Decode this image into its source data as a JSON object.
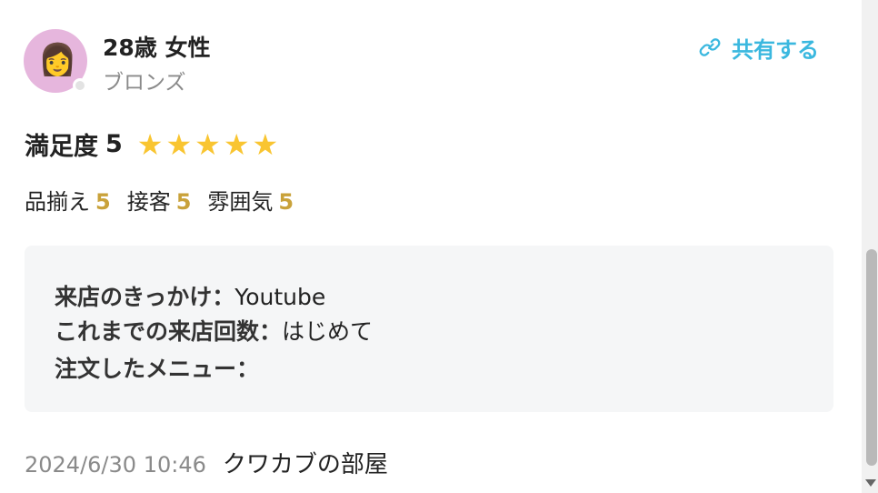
{
  "user": {
    "name": "28歳 女性",
    "rank": "ブロンズ",
    "avatar_emoji": "👩"
  },
  "share": {
    "label": "共有する",
    "icon": "link-icon",
    "color": "#3bb8df"
  },
  "satisfaction": {
    "label": "満足度",
    "score": "5",
    "stars": 5,
    "max_stars": 5,
    "star_color": "#f9c531"
  },
  "sub_ratings": [
    {
      "label": "品揃え",
      "score": "5"
    },
    {
      "label": "接客",
      "score": "5"
    },
    {
      "label": "雰囲気",
      "score": "5"
    }
  ],
  "info": {
    "trigger_label": "来店のきっかけ：",
    "trigger_value": "Youtube",
    "visits_label": "これまでの来店回数：",
    "visits_value": "はじめて",
    "menu_label": "注文したメニュー：",
    "menu_value": ""
  },
  "footer": {
    "date": "2024/6/30 10:46",
    "shop": "クワカブの部屋"
  },
  "scrollbar": {
    "position_fraction": 0.5
  }
}
